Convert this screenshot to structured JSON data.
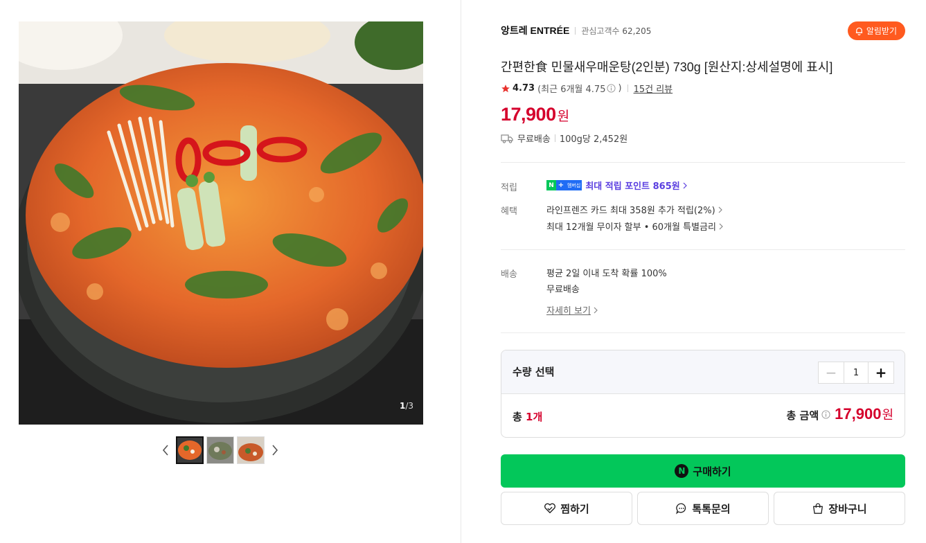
{
  "gallery": {
    "counter_current": "1",
    "counter_total": "/3",
    "thumbnail_count": 3,
    "active_thumbnail": 1
  },
  "store": {
    "name": "앙트레 ENTRÉE",
    "followers_label": "관심고객수",
    "followers_count": "62,205",
    "alarm_label": "알림받기"
  },
  "product": {
    "title": "간편한食 민물새우매운탕(2인분) 730g [원산지:상세설명에 표시]",
    "rating": "4.73",
    "recent_rating": "(최근 6개월 4.75",
    "recent_rating_close": ")",
    "review_link": "15건 리뷰",
    "price": "17,900",
    "currency": "원",
    "shipping": "무료배송",
    "unit_price": "100g당 2,452원"
  },
  "benefits": {
    "points_label": "적립",
    "badge_n": "N",
    "badge_plus": "+",
    "badge_member": "멤버십",
    "points_text": "최대 적립 포인트 865원",
    "benefit_label": "혜택",
    "card_benefit": "라인프렌즈 카드 최대 358원 추가 적립(2%)",
    "installment": "최대 12개월 무이자 할부 • 60개월 특별금리"
  },
  "delivery": {
    "label": "배송",
    "arrival": "평균 2일 이내 도착 확률 100%",
    "free": "무료배송",
    "detail_link": "자세히 보기"
  },
  "quantity": {
    "title": "수량 선택",
    "minus": "−",
    "value": "1",
    "plus": "+",
    "total_prefix": "총 ",
    "total_count": "1개",
    "total_amount_label": "총 금액",
    "total_price": "17,900",
    "currency": "원"
  },
  "actions": {
    "buy_icon": "N",
    "buy_label": "구매하기",
    "wish_label": "찜하기",
    "talk_label": "톡톡문의",
    "cart_label": "장바구니"
  },
  "colors": {
    "price_red": "#d5002c",
    "naver_green": "#03c75a",
    "alarm_orange": "#ff5a1f",
    "points_purple": "#5a3ee0"
  }
}
